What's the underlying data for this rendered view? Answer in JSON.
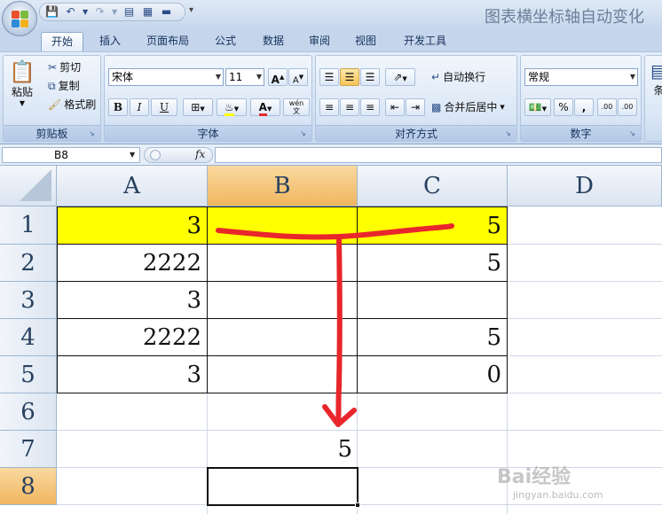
{
  "window": {
    "title": "图表横坐标轴自动变化"
  },
  "qat": {
    "save_icon": "save-icon",
    "undo_icon": "undo-icon",
    "redo_icon": "redo-icon"
  },
  "tabs": [
    {
      "label": "开始",
      "active": true
    },
    {
      "label": "插入"
    },
    {
      "label": "页面布局"
    },
    {
      "label": "公式"
    },
    {
      "label": "数据"
    },
    {
      "label": "审阅"
    },
    {
      "label": "视图"
    },
    {
      "label": "开发工具"
    }
  ],
  "ribbon": {
    "clipboard": {
      "label": "剪贴板",
      "paste": "粘贴",
      "cut": "剪切",
      "copy": "复制",
      "format_painter": "格式刷"
    },
    "font": {
      "label": "字体",
      "font_name": "宋体",
      "font_size": "11",
      "grow": "A",
      "shrink": "A",
      "bold": "B",
      "italic": "I",
      "underline": "U",
      "font_color": "A",
      "phonetic": "wén"
    },
    "alignment": {
      "label": "对齐方式",
      "wrap_text": "自动换行",
      "merge_center": "合并后居中"
    },
    "number": {
      "label": "数字",
      "format": "常规",
      "percent": "%",
      "comma": ",",
      "inc_decimal": ".00",
      "dec_decimal": ".00"
    },
    "styles": {
      "partial_label": "条"
    }
  },
  "formula_bar": {
    "name_box": "B8",
    "fx": "fx",
    "formula": ""
  },
  "sheet": {
    "columns": [
      "A",
      "B",
      "C",
      "D"
    ],
    "rows": [
      "1",
      "2",
      "3",
      "4",
      "5",
      "6",
      "7",
      "8"
    ],
    "selected_cell": "B8",
    "cells": {
      "A1": "3",
      "C1": "5",
      "A2": "2222",
      "C2": "5",
      "A3": "3",
      "A4": "2222",
      "C4": "5",
      "A5": "3",
      "C5": "0",
      "B7": "5"
    },
    "highlight_color": "#ffff00",
    "annotation_color": "#e8262b"
  },
  "watermark": {
    "text": "Bai经验",
    "url": "jingyan.baidu.com"
  }
}
